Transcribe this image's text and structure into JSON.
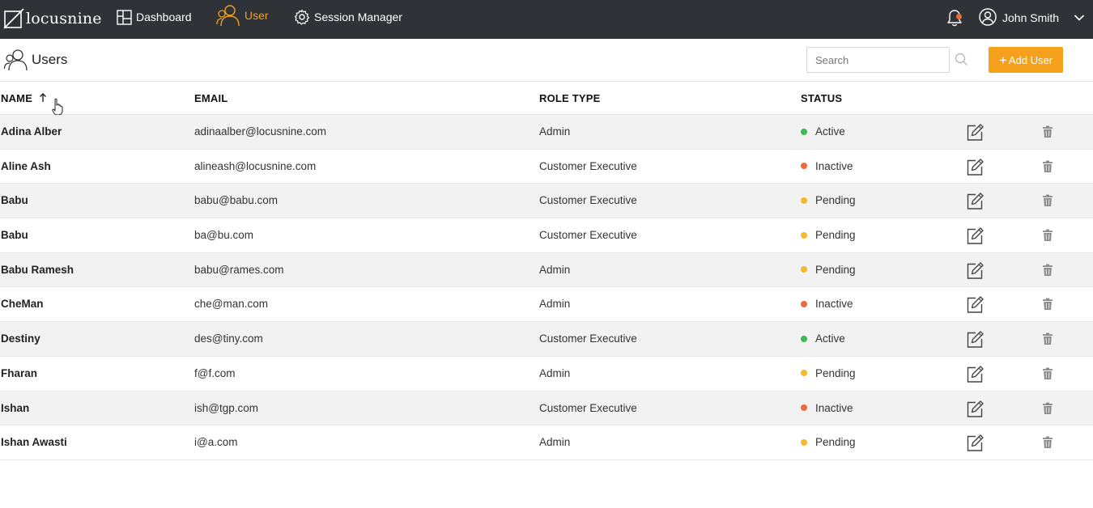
{
  "brand": {
    "name": "locusnine"
  },
  "nav": {
    "items": [
      {
        "label": "Dashboard",
        "icon": "dashboard-icon"
      },
      {
        "label": "User",
        "icon": "user-icon",
        "active": true
      },
      {
        "label": "Session Manager",
        "icon": "gear-icon"
      }
    ],
    "account_name": "John Smith",
    "notification_icon": "bell-icon"
  },
  "page": {
    "title": "Users",
    "search_placeholder": "Search",
    "add_button_label": "Add User",
    "add_button_symbol": "+"
  },
  "table": {
    "columns": {
      "name": "NAME",
      "email": "EMAIL",
      "role": "ROLE TYPE",
      "status": "STATUS"
    },
    "sort": {
      "column": "name",
      "direction": "ascending"
    },
    "rows": [
      {
        "name": "Adina Alber",
        "email": "adinaalber@locusnine.com",
        "role": "Admin",
        "status": "Active"
      },
      {
        "name": "Aline Ash",
        "email": "alineash@locusnine.com",
        "role": "Customer Executive",
        "status": "Inactive"
      },
      {
        "name": "Babu",
        "email": "babu@babu.com",
        "role": "Customer Executive",
        "status": "Pending"
      },
      {
        "name": "Babu",
        "email": "ba@bu.com",
        "role": "Customer Executive",
        "status": "Pending"
      },
      {
        "name": "Babu Ramesh",
        "email": "babu@rames.com",
        "role": "Admin",
        "status": "Pending"
      },
      {
        "name": "CheMan",
        "email": "che@man.com",
        "role": "Admin",
        "status": "Inactive"
      },
      {
        "name": "Destiny",
        "email": "des@tiny.com",
        "role": "Customer Executive",
        "status": "Active"
      },
      {
        "name": "Fharan",
        "email": "f@f.com",
        "role": "Admin",
        "status": "Pending"
      },
      {
        "name": "Ishan",
        "email": "ish@tgp.com",
        "role": "Customer Executive",
        "status": "Inactive"
      },
      {
        "name": "Ishan Awasti",
        "email": "i@a.com",
        "role": "Admin",
        "status": "Pending"
      }
    ]
  },
  "colors": {
    "topbar": "#2f3338",
    "accent": "#f5a11c",
    "active_nav": "#f2a020",
    "status": {
      "Active": "#3cba54",
      "Inactive": "#ef6a3a",
      "Pending": "#f5b82e"
    },
    "notification_dot": "#ef6a3a"
  }
}
